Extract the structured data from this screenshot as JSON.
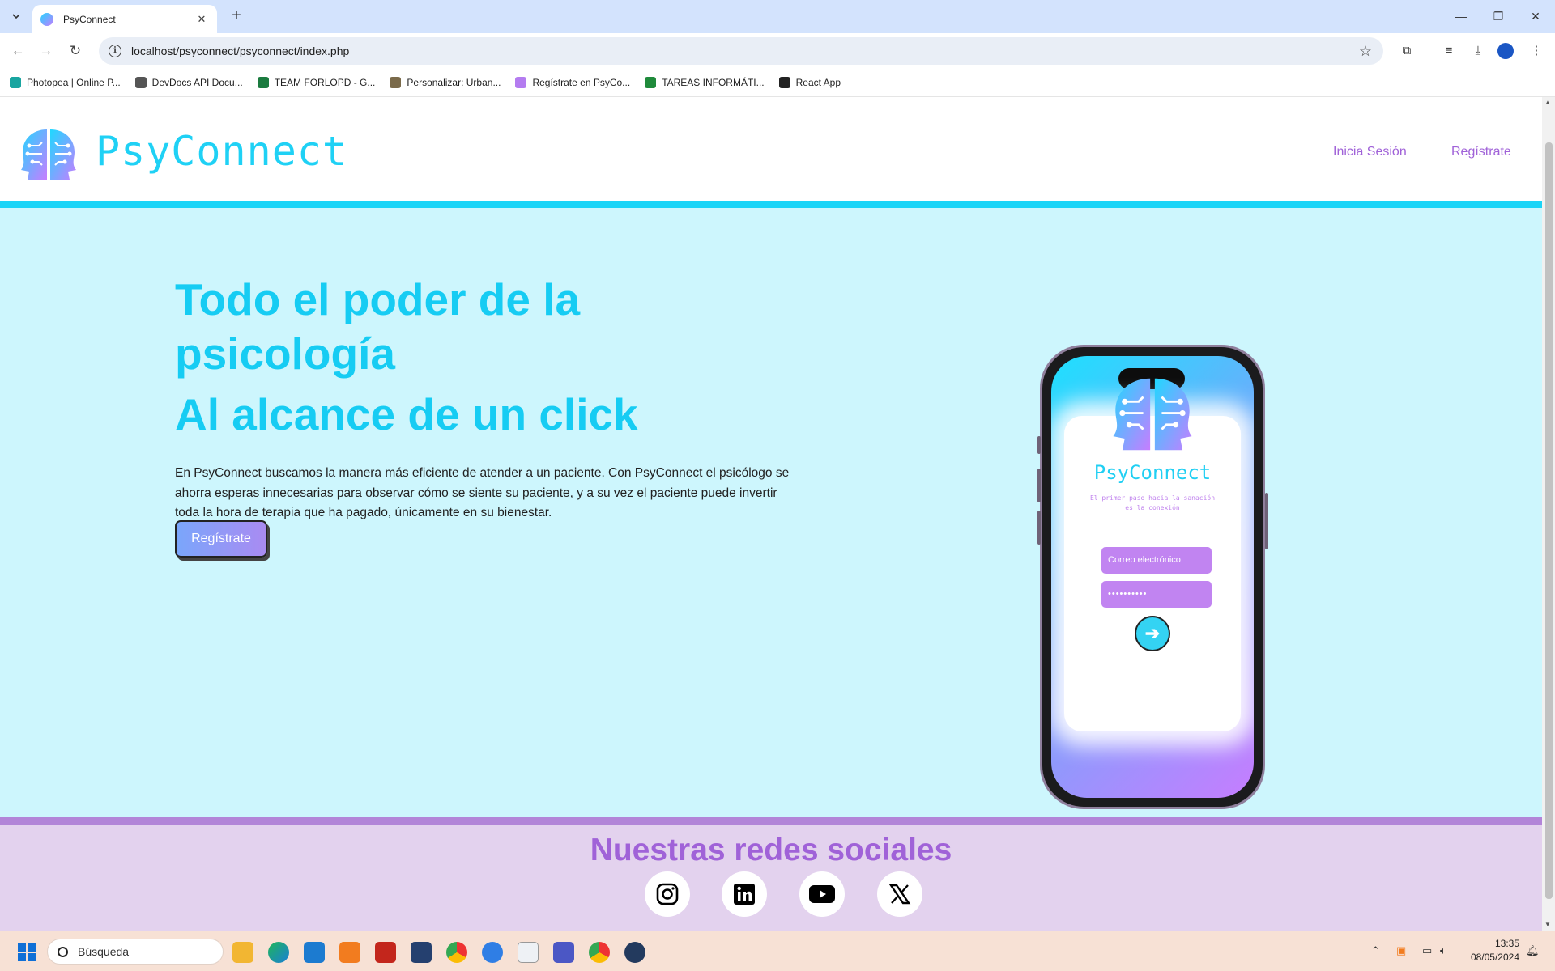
{
  "browser": {
    "tab_title": "PsyConnect",
    "url": "localhost/psyconnect/psyconnect/index.php",
    "bookmarks": [
      {
        "label": "Photopea | Online P...",
        "color": "#19a5a0"
      },
      {
        "label": "DevDocs API Docu...",
        "color": "#555555"
      },
      {
        "label": "TEAM FORLOPD - G...",
        "color": "#1b7b3f"
      },
      {
        "label": "Personalizar: Urban...",
        "color": "#7a6a4a"
      },
      {
        "label": "Regístrate en PsyCo...",
        "color": "#b47cf0"
      },
      {
        "label": "TAREAS INFORMÁTI...",
        "color": "#1f8a3b"
      },
      {
        "label": "React App",
        "color": "#222222"
      }
    ]
  },
  "site": {
    "brand": "PsyConnect",
    "nav": {
      "login": "Inicia Sesión",
      "register": "Regístrate"
    },
    "hero": {
      "title_line1": "Todo el poder de la psicología",
      "title_line2": "Al alcance de un click",
      "description": "En PsyConnect buscamos la manera más eficiente de atender a un paciente. Con PsyConnect el psicólogo se ahorra esperas innecesarias para observar cómo se siente su paciente, y a su vez el paciente puede invertir toda la hora de terapia que ha pagado, únicamente en su bienestar.",
      "cta": "Regístrate"
    },
    "mockup": {
      "brand": "PsyConnect",
      "tagline": "El primer paso hacia la sanación es la conexión",
      "email_placeholder": "Correo electrónico",
      "password_mask": "••••••••••"
    },
    "footer": {
      "title": "Nuestras redes sociales",
      "socials": [
        "instagram",
        "linkedin",
        "youtube",
        "x"
      ]
    }
  },
  "colors": {
    "accent_cyan": "#1fd1f5",
    "accent_purple": "#a062d8",
    "hero_bg": "#cdf6fd",
    "footer_bg": "#e3d2ee"
  },
  "taskbar": {
    "search_placeholder": "Búsqueda",
    "time": "13:35",
    "date": "08/05/2024"
  }
}
